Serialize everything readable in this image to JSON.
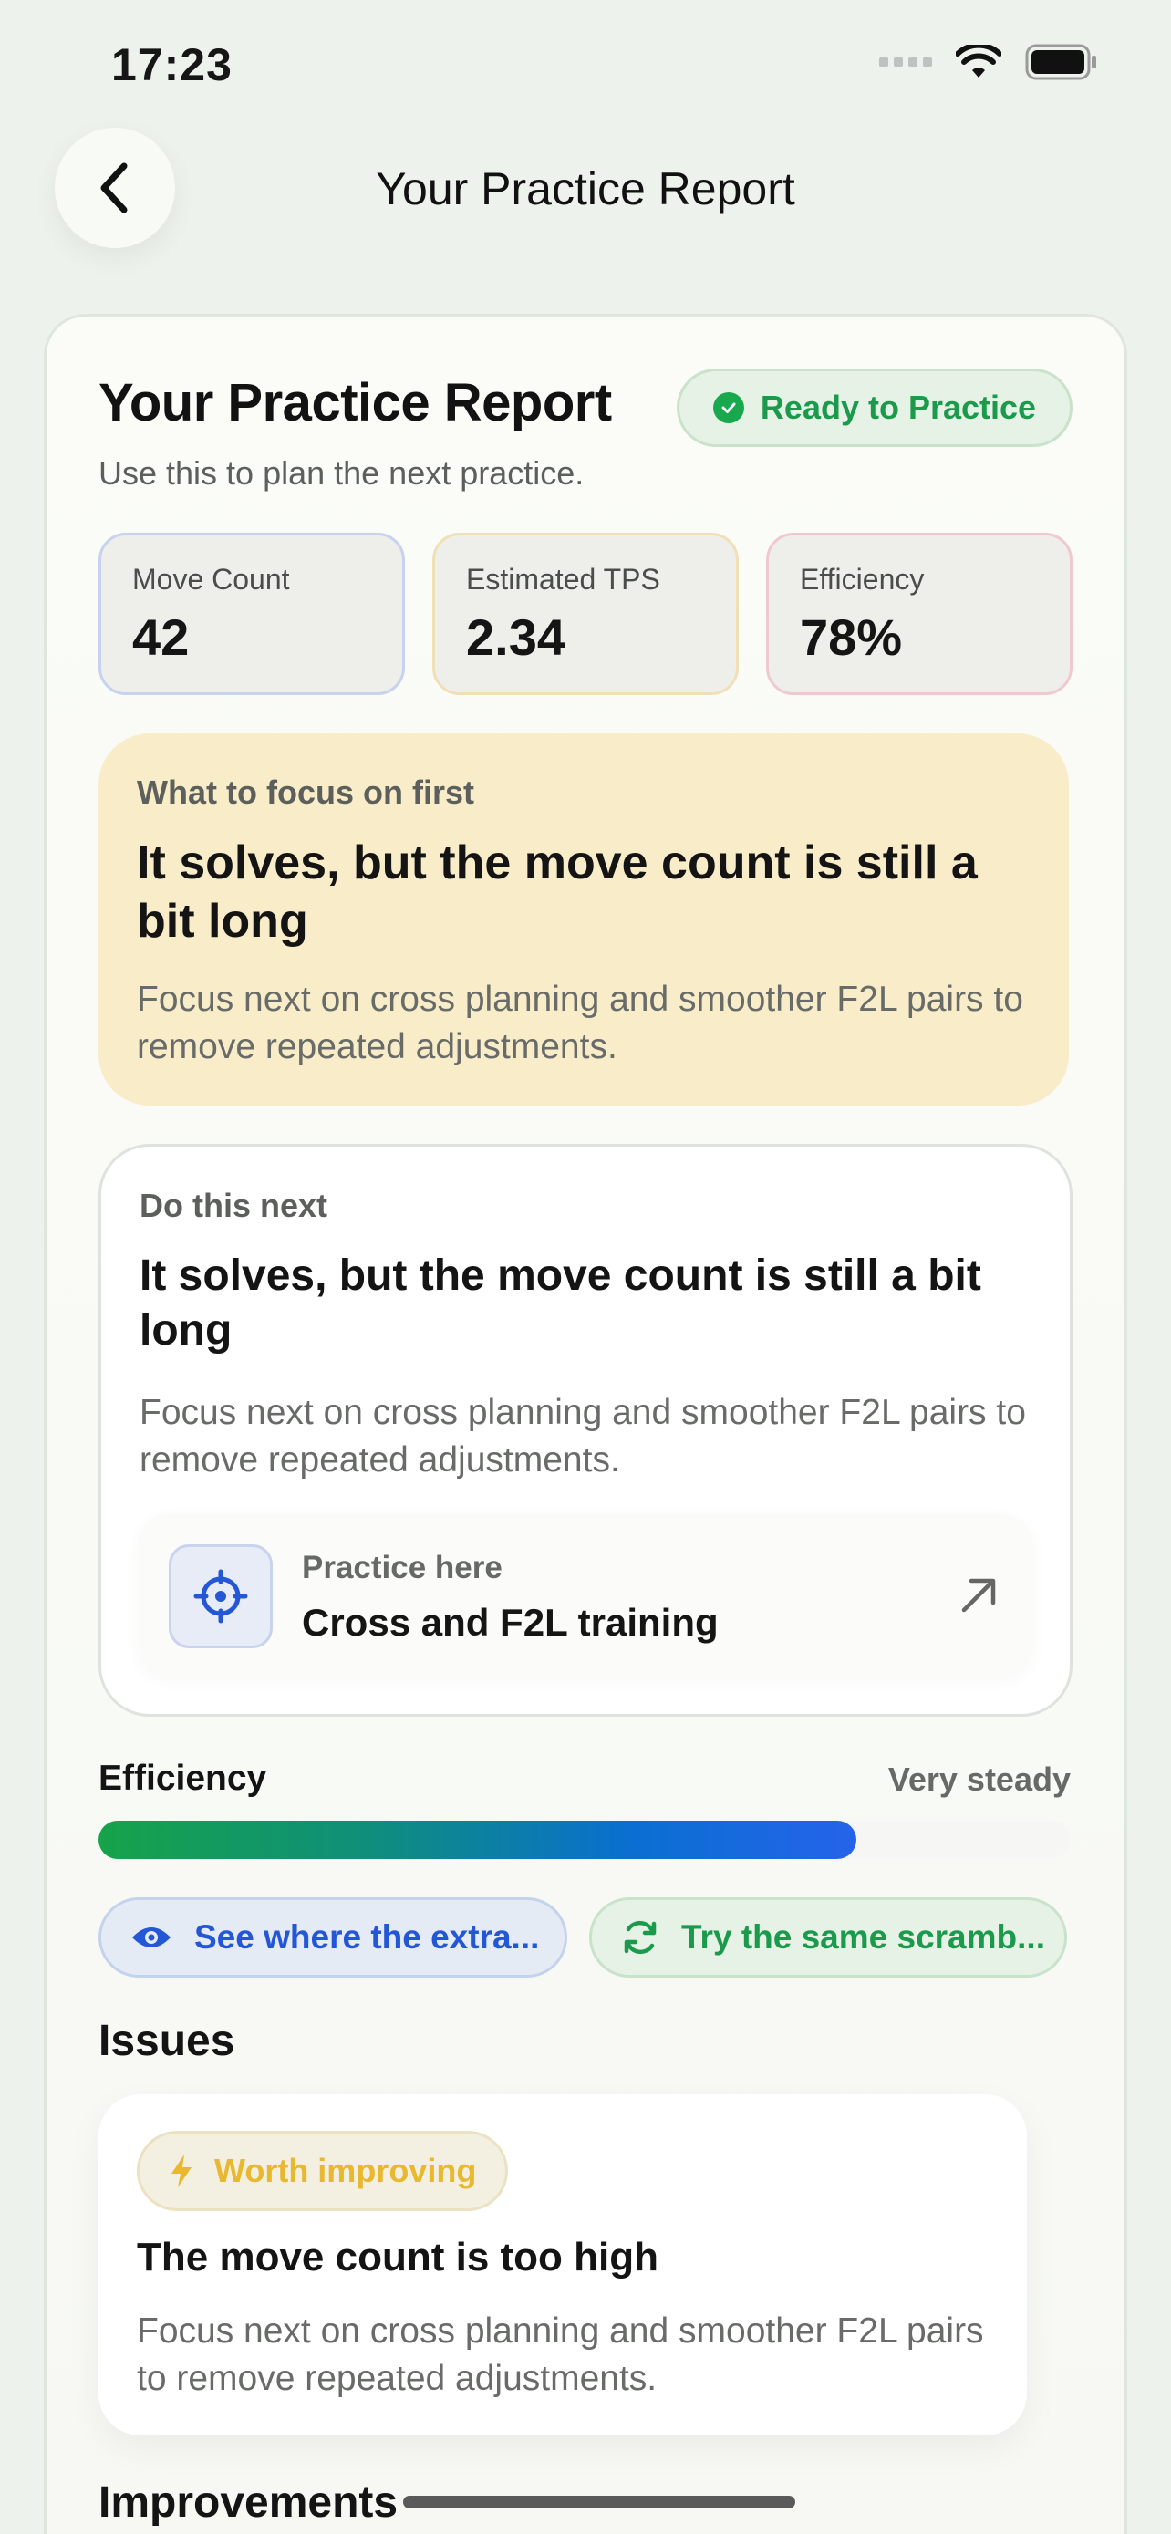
{
  "status_bar": {
    "time": "17:23"
  },
  "nav": {
    "title": "Your Practice Report"
  },
  "report": {
    "title": "Your Practice Report",
    "status_badge": "Ready to Practice",
    "subtitle": "Use this to plan the next practice."
  },
  "metrics": [
    {
      "label": "Move Count",
      "value": "42",
      "border": "#c6d2ee"
    },
    {
      "label": "Estimated TPS",
      "value": "2.34",
      "border": "#f1dfb5"
    },
    {
      "label": "Efficiency",
      "value": "78%",
      "border": "#f0c9ce"
    }
  ],
  "focus": {
    "eyebrow": "What to focus on first",
    "headline": "It solves, but the move count is still a bit long",
    "body": "Focus next on cross planning and smoother F2L pairs to remove repeated adjustments."
  },
  "next": {
    "eyebrow": "Do this next",
    "headline": "It solves, but the move count is still a bit long",
    "body": "Focus next on cross planning and smoother F2L pairs to remove repeated adjustments.",
    "practice_label": "Practice here",
    "practice_name": "Cross and F2L training"
  },
  "efficiency": {
    "label": "Efficiency",
    "value_text": "Very steady",
    "level_percent": 78
  },
  "chips": {
    "see_extra": "See where the extra...",
    "try_same": "Try the same scramb..."
  },
  "issues": {
    "title": "Issues",
    "items": [
      {
        "badge": "Worth improving",
        "title": "The move count is too high",
        "body": "Focus next on cross planning and smoother F2L pairs to remove repeated adjustments."
      }
    ]
  },
  "improvements": {
    "title": "Improvements"
  },
  "colors": {
    "accent_green": "#1b9a4b",
    "accent_blue": "#2457d6",
    "warning_yellow": "#e8b830",
    "focus_bg": "#f8edc8"
  },
  "icons": [
    "chevron-left-icon",
    "check-circle-icon",
    "crosshair-icon",
    "arrow-up-right-icon",
    "eye-icon",
    "refresh-icon",
    "bolt-icon",
    "wifi-icon",
    "battery-icon"
  ]
}
